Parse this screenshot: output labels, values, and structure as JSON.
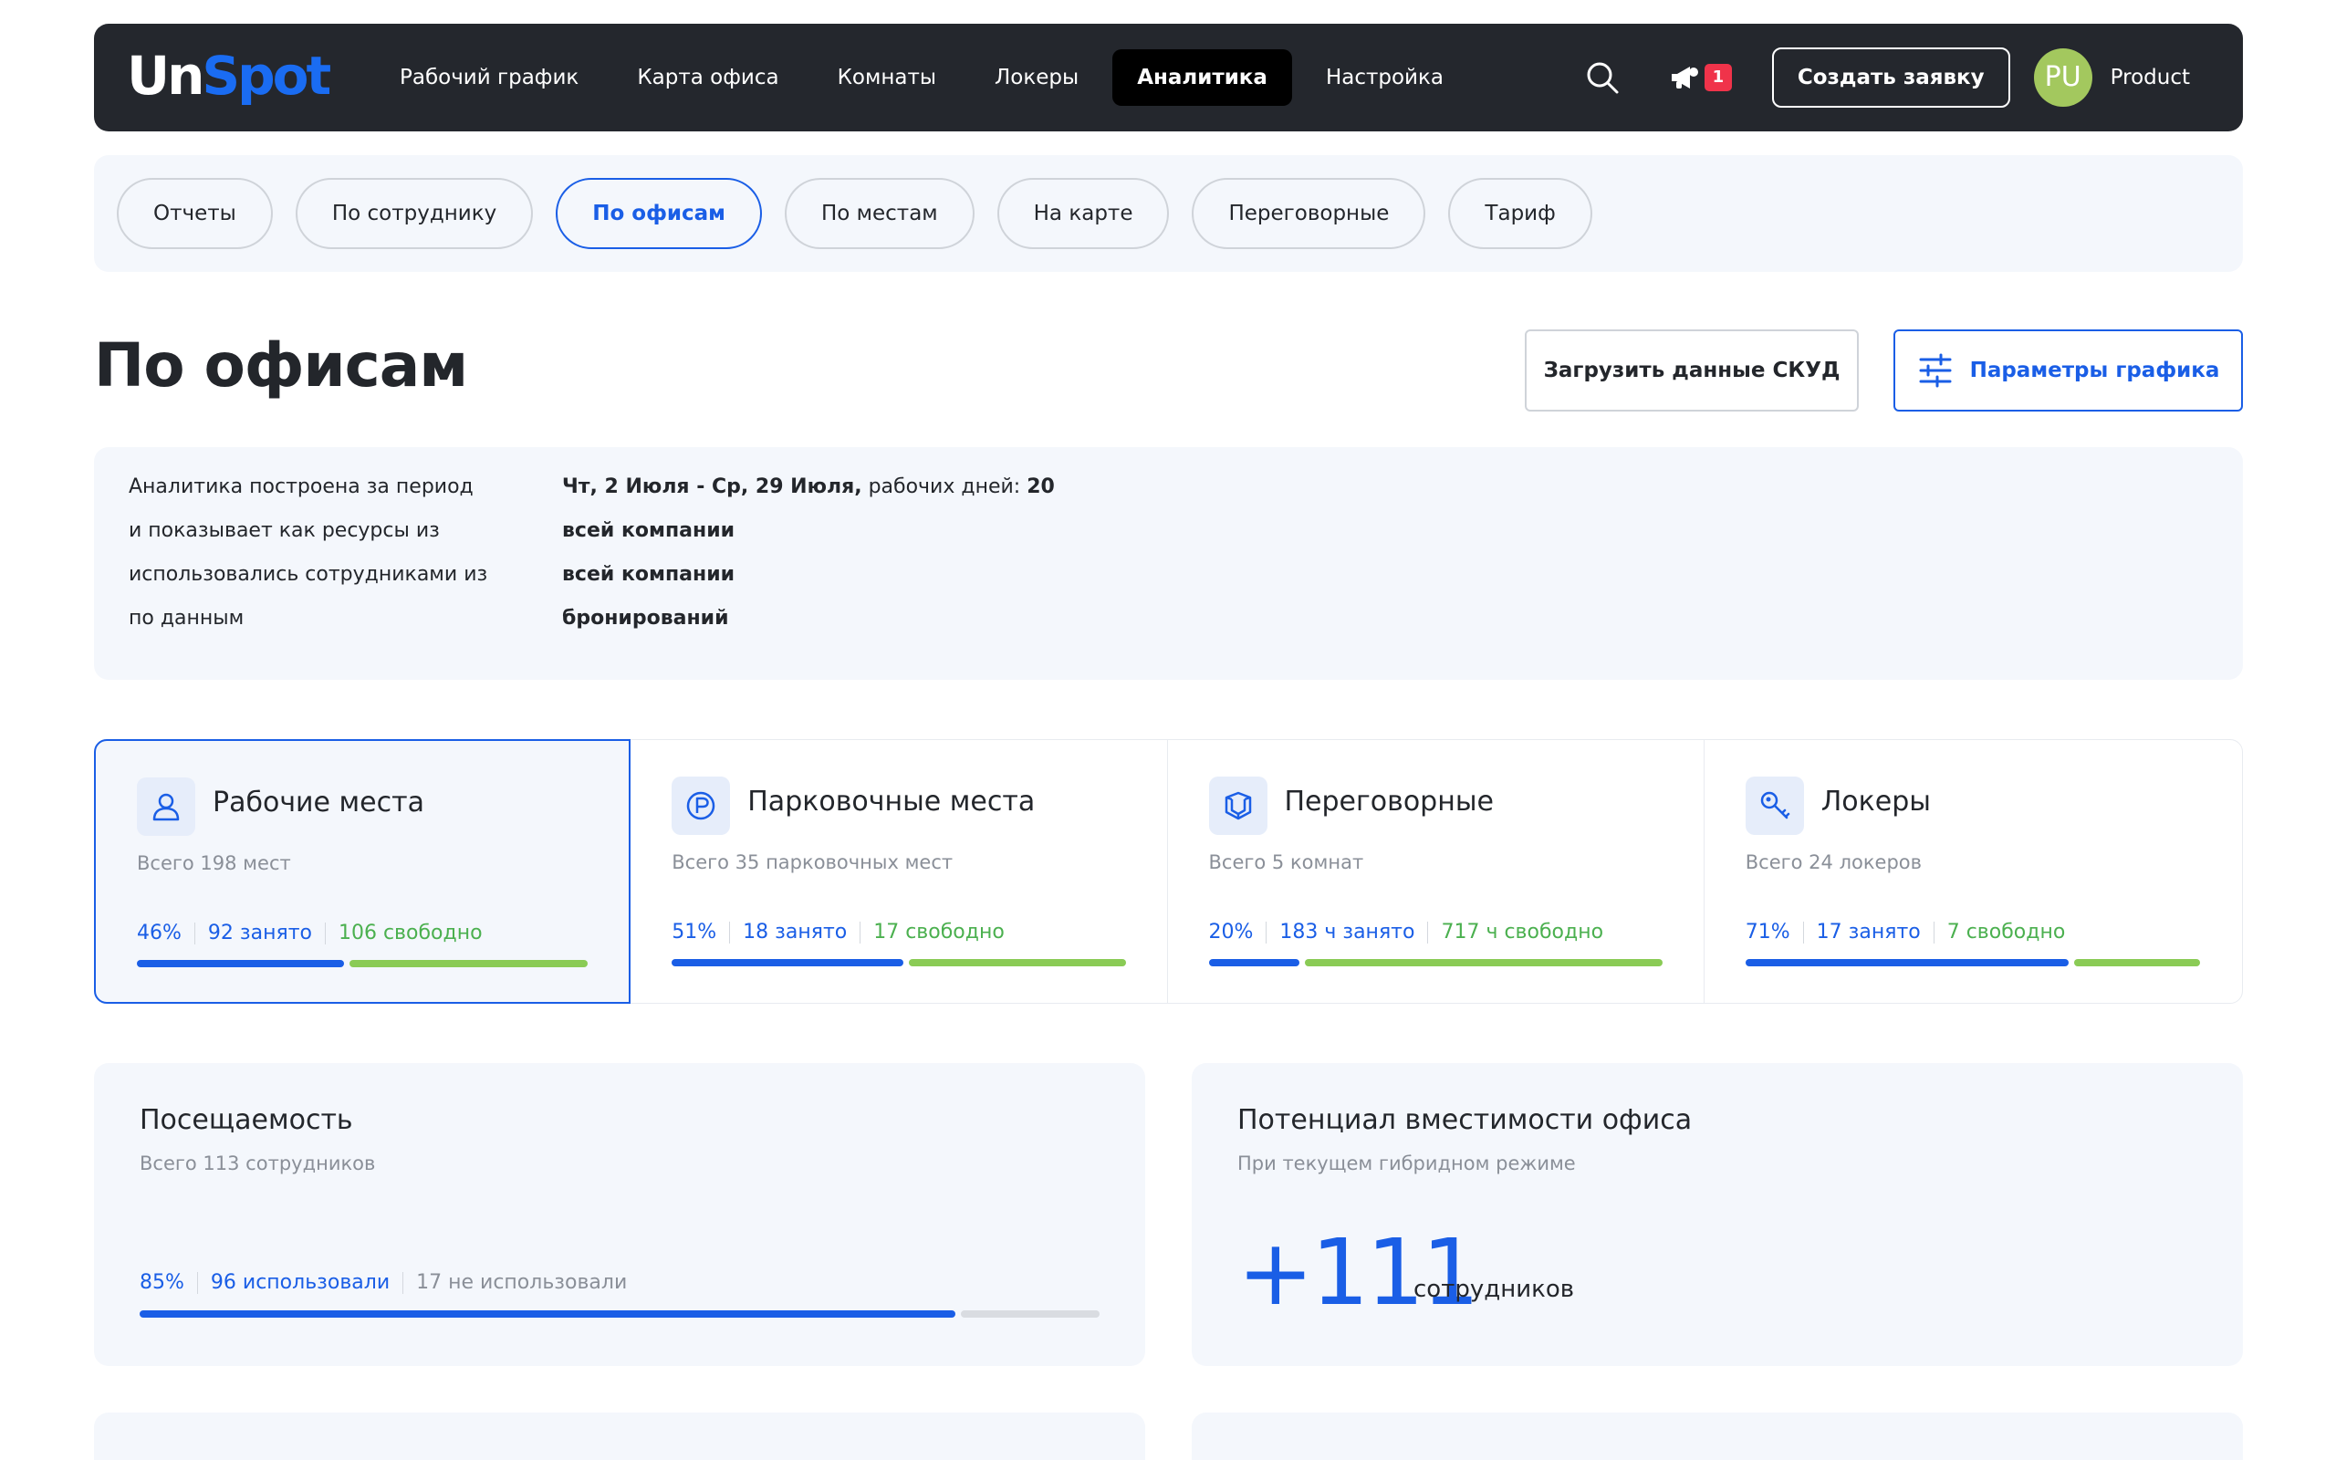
{
  "logo": {
    "part1": "Un",
    "part2": "Spot"
  },
  "nav": {
    "items": [
      {
        "label": "Рабочий график"
      },
      {
        "label": "Карта офиса"
      },
      {
        "label": "Комнаты"
      },
      {
        "label": "Локеры"
      },
      {
        "label": "Аналитика",
        "active": true
      },
      {
        "label": "Настройка"
      }
    ]
  },
  "header": {
    "notifications_count": "1",
    "create_button": "Создать заявку",
    "avatar_initials": "PU",
    "user_name": "Product"
  },
  "subtabs": [
    {
      "label": "Отчеты"
    },
    {
      "label": "По сотруднику"
    },
    {
      "label": "По офисам",
      "active": true
    },
    {
      "label": "По местам"
    },
    {
      "label": "На карте"
    },
    {
      "label": "Переговорные"
    },
    {
      "label": "Тариф"
    }
  ],
  "page": {
    "title": "По офисам",
    "upload_button": "Загрузить данные СКУД",
    "params_button": "Параметры графика"
  },
  "info": {
    "left_lines": [
      "Аналитика построена за период",
      "и показывает как ресурсы из",
      "использовались сотрудниками из",
      "по данным"
    ],
    "period_bold": "Чт, 2 Июля - Ср, 29 Июля,",
    "period_text": " рабочих дней: ",
    "period_days": "20",
    "resources": "всей компании",
    "employees": "всей компании",
    "source": "бронирований"
  },
  "stats": [
    {
      "title": "Рабочие места",
      "icon": "user-icon",
      "subtitle": "Всего 198 мест",
      "pct": "46%",
      "busy": "92 занято",
      "free": "106 свободно",
      "fill": 0.46,
      "selected": true
    },
    {
      "title": "Парковочные места",
      "icon": "parking-icon",
      "subtitle": "Всего 35 парковочных мест",
      "pct": "51%",
      "busy": "18 занято",
      "free": "17 свободно",
      "fill": 0.51
    },
    {
      "title": "Переговорные",
      "icon": "meeting-room-icon",
      "subtitle": "Всего 5 комнат",
      "pct": "20%",
      "busy": "183 ч занято",
      "free": "717 ч свободно",
      "fill": 0.2
    },
    {
      "title": "Локеры",
      "icon": "key-icon",
      "subtitle": "Всего 24 локеров",
      "pct": "71%",
      "busy": "17 занято",
      "free": "7 свободно",
      "fill": 0.71
    }
  ],
  "attendance": {
    "title": "Посещаемость",
    "subtitle": "Всего 113 сотрудников",
    "pct": "85%",
    "used": "96 использовали",
    "unused": "17 не использовали",
    "fill": 0.85
  },
  "capacity": {
    "title": "Потенциал вместимости офиса",
    "subtitle": "При текущем гибридном режиме",
    "value": "+111",
    "unit": "сотрудников"
  },
  "colors": {
    "accent": "#1a5ee6",
    "free": "#8acb55",
    "nav_bg": "#24272d",
    "panel_bg": "#f4f7fc",
    "badge": "#f0334a",
    "avatar": "#a3c85e"
  }
}
